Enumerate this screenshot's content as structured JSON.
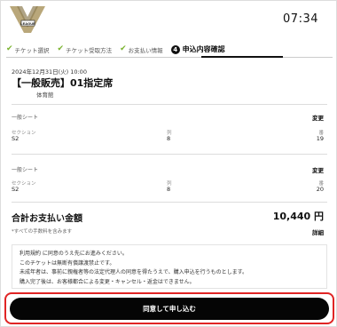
{
  "header": {
    "timer": "07:34",
    "logo_text": "LEAGUE",
    "colors": {
      "logo_gold": "#b9a77a"
    }
  },
  "steps": [
    {
      "label": "チケット選択"
    },
    {
      "label": "チケット受取方法"
    },
    {
      "label": "お支払い情報"
    },
    {
      "number": "4",
      "label": "申込内容確認"
    }
  ],
  "event": {
    "date": "2024年12月31日(火) 10:00",
    "title": "【一般販売】01指定席",
    "venue": "体育館"
  },
  "tickets": [
    {
      "type": "一般シート",
      "change_label": "変更",
      "headers": {
        "section": "セクション",
        "row": "列",
        "seat": "番"
      },
      "values": {
        "section": "S2",
        "row": "8",
        "seat": "19"
      }
    },
    {
      "type": "一般シート",
      "change_label": "変更",
      "headers": {
        "section": "セクション",
        "row": "列",
        "seat": "番"
      },
      "values": {
        "section": "S2",
        "row": "8",
        "seat": "20"
      }
    }
  ],
  "total": {
    "label": "合計お支払い金額",
    "amount": "10,440 円",
    "tax_note": "*すべての手数料を含みます",
    "detail_label": "詳細"
  },
  "notes": [
    "利用規約 に同意のうえ先にお進みください。",
    "このチケットは無断有償譲渡禁止です。",
    "未成年者は、事前に親権者等の法定代理人の同意を得たうえで、購入申込を行うものとします。",
    "購入完了後は、お客様都合による変更・キャンセル・返金はできません。"
  ],
  "cta": {
    "label": "同意して申し込む"
  },
  "colors": {
    "accent_green": "#7ab32e",
    "outline_red": "#e02424",
    "button_bg": "#050505"
  }
}
